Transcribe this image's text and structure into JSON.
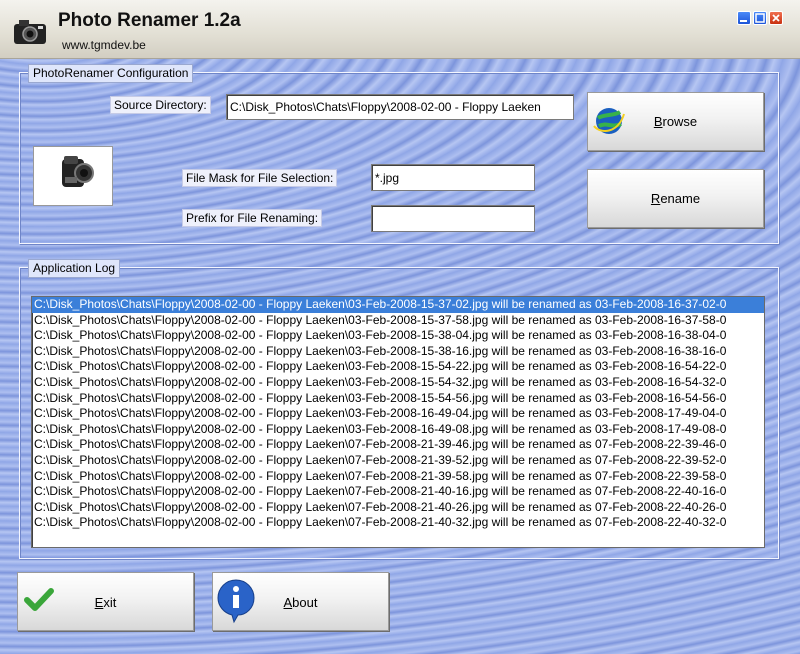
{
  "window": {
    "title": "Photo Renamer 1.2a",
    "url": "www.tgmdev.be"
  },
  "config": {
    "legend": "PhotoRenamer Configuration",
    "source_label": "Source Directory:",
    "source_value": "C:\\Disk_Photos\\Chats\\Floppy\\2008-02-00 - Floppy Laeken",
    "mask_label": "File Mask for File Selection:",
    "mask_value": "*.jpg",
    "prefix_label": "Prefix for File Renaming:",
    "prefix_value": "",
    "browse_label": "Browse",
    "rename_label": "Rename"
  },
  "log": {
    "legend": "Application Log",
    "selected_index": 0,
    "lines": [
      "C:\\Disk_Photos\\Chats\\Floppy\\2008-02-00 - Floppy Laeken\\03-Feb-2008-15-37-02.jpg will be renamed as 03-Feb-2008-16-37-02-0",
      "C:\\Disk_Photos\\Chats\\Floppy\\2008-02-00 - Floppy Laeken\\03-Feb-2008-15-37-58.jpg will be renamed as 03-Feb-2008-16-37-58-0",
      "C:\\Disk_Photos\\Chats\\Floppy\\2008-02-00 - Floppy Laeken\\03-Feb-2008-15-38-04.jpg will be renamed as 03-Feb-2008-16-38-04-0",
      "C:\\Disk_Photos\\Chats\\Floppy\\2008-02-00 - Floppy Laeken\\03-Feb-2008-15-38-16.jpg will be renamed as 03-Feb-2008-16-38-16-0",
      "C:\\Disk_Photos\\Chats\\Floppy\\2008-02-00 - Floppy Laeken\\03-Feb-2008-15-54-22.jpg will be renamed as 03-Feb-2008-16-54-22-0",
      "C:\\Disk_Photos\\Chats\\Floppy\\2008-02-00 - Floppy Laeken\\03-Feb-2008-15-54-32.jpg will be renamed as 03-Feb-2008-16-54-32-0",
      "C:\\Disk_Photos\\Chats\\Floppy\\2008-02-00 - Floppy Laeken\\03-Feb-2008-15-54-56.jpg will be renamed as 03-Feb-2008-16-54-56-0",
      "C:\\Disk_Photos\\Chats\\Floppy\\2008-02-00 - Floppy Laeken\\03-Feb-2008-16-49-04.jpg will be renamed as 03-Feb-2008-17-49-04-0",
      "C:\\Disk_Photos\\Chats\\Floppy\\2008-02-00 - Floppy Laeken\\03-Feb-2008-16-49-08.jpg will be renamed as 03-Feb-2008-17-49-08-0",
      "C:\\Disk_Photos\\Chats\\Floppy\\2008-02-00 - Floppy Laeken\\07-Feb-2008-21-39-46.jpg will be renamed as 07-Feb-2008-22-39-46-0",
      "C:\\Disk_Photos\\Chats\\Floppy\\2008-02-00 - Floppy Laeken\\07-Feb-2008-21-39-52.jpg will be renamed as 07-Feb-2008-22-39-52-0",
      "C:\\Disk_Photos\\Chats\\Floppy\\2008-02-00 - Floppy Laeken\\07-Feb-2008-21-39-58.jpg will be renamed as 07-Feb-2008-22-39-58-0",
      "C:\\Disk_Photos\\Chats\\Floppy\\2008-02-00 - Floppy Laeken\\07-Feb-2008-21-40-16.jpg will be renamed as 07-Feb-2008-22-40-16-0",
      "C:\\Disk_Photos\\Chats\\Floppy\\2008-02-00 - Floppy Laeken\\07-Feb-2008-21-40-26.jpg will be renamed as 07-Feb-2008-22-40-26-0",
      "C:\\Disk_Photos\\Chats\\Floppy\\2008-02-00 - Floppy Laeken\\07-Feb-2008-21-40-32.jpg will be renamed as 07-Feb-2008-22-40-32-0"
    ]
  },
  "footer": {
    "exit_label": "Exit",
    "about_label": "About"
  },
  "icons": {
    "app": "camera-icon",
    "browse": "globe-icon",
    "exit": "checkmark-icon",
    "about": "info-icon"
  },
  "colors": {
    "selection": "#3b7fd9",
    "background": "#9fb3ec"
  }
}
